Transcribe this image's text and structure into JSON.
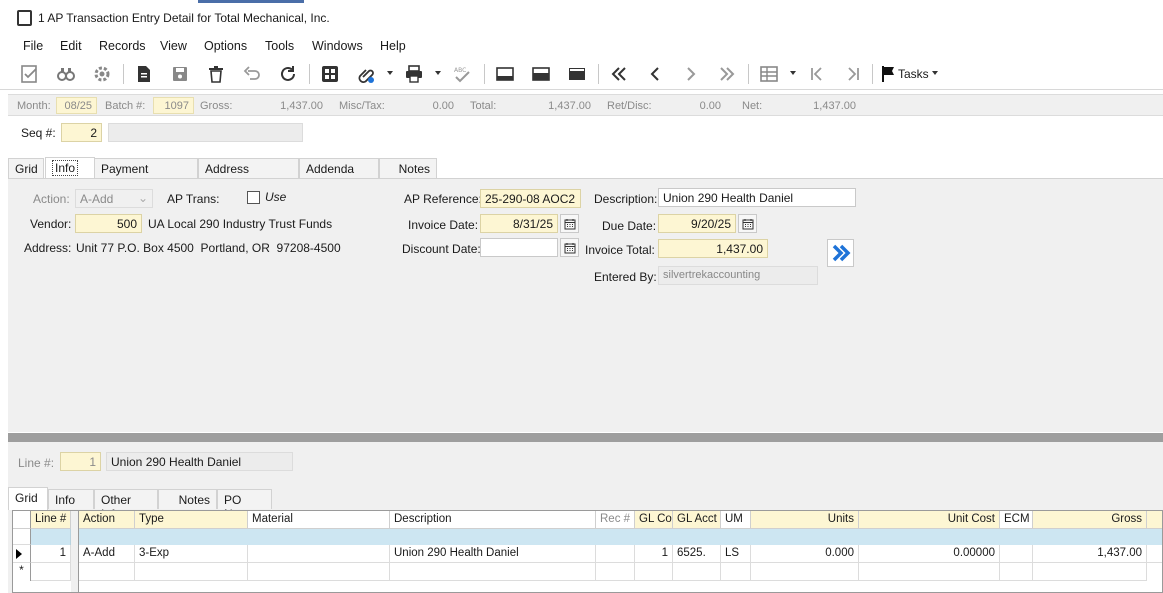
{
  "window": {
    "title": "1 AP Transaction Entry Detail for Total Mechanical, Inc."
  },
  "menu": [
    "File",
    "Edit",
    "Records",
    "View",
    "Options",
    "Tools",
    "Windows",
    "Help"
  ],
  "toolbar": {
    "tasks_label": "Tasks",
    "icons": [
      "validate-icon",
      "find-icon",
      "settings-icon",
      "new-record-icon",
      "save-icon",
      "delete-icon",
      "undo-icon",
      "refresh-icon",
      "related-icon",
      "attach-icon",
      "print-icon",
      "spellcheck-icon",
      "layout-1-icon",
      "layout-2-icon",
      "layout-3-icon",
      "first-icon",
      "previous-icon",
      "next-icon",
      "last-icon",
      "grid-view-icon",
      "begin-icon",
      "end-icon",
      "flag-icon"
    ]
  },
  "batch": {
    "month_label": "Month:",
    "month_value": "08/25",
    "batch_label": "Batch #:",
    "batch_value": "1097",
    "gross_label": "Gross:",
    "gross_value": "1,437.00",
    "misc_label": "Misc/Tax:",
    "misc_value": "0.00",
    "total_label": "Total:",
    "total_value": "1,437.00",
    "ret_label": "Ret/Disc:",
    "ret_value": "0.00",
    "net_label": "Net:",
    "net_value": "1,437.00"
  },
  "seq": {
    "label": "Seq #:",
    "value": "2",
    "desc": ""
  },
  "header_tabs": [
    "Grid",
    "Info",
    "Payment Overrides",
    "Address Overrides",
    "Addenda Info",
    "Notes"
  ],
  "info": {
    "action_label": "Action:",
    "action_value": "A-Add",
    "ap_trans_label": "AP Trans:",
    "use_label": "Use",
    "vendor_label": "Vendor:",
    "vendor_value": "500",
    "vendor_name": "UA Local 290 Industry Trust Funds",
    "address_label": "Address:",
    "address_value": "Unit 77 P.O. Box 4500  Portland, OR  97208-4500",
    "apref_label": "AP Reference:",
    "apref_value": "25-290-08 AOC2",
    "invdate_label": "Invoice Date:",
    "invdate_value": "8/31/25",
    "discdate_label": "Discount Date:",
    "discdate_value": "",
    "desc_label": "Description:",
    "desc_value": "Union 290 Health Daniel",
    "duedate_label": "Due Date:",
    "duedate_value": "9/20/25",
    "invtotal_label": "Invoice Total:",
    "invtotal_value": "1,437.00",
    "enteredby_label": "Entered By:",
    "enteredby_value": "silvertrekaccounting"
  },
  "line": {
    "label": "Line #:",
    "value": "1",
    "desc": "Union 290 Health Daniel"
  },
  "line_tabs": [
    "Grid",
    "Info",
    "Other Info",
    "Notes",
    "PO Notes"
  ],
  "grid": {
    "columns": [
      "Line #",
      "Action",
      "Type",
      "Material",
      "Description",
      "Rec #",
      "GL Co",
      "GL Acct",
      "UM",
      "Units",
      "Unit Cost",
      "ECM",
      "Gross"
    ],
    "rows": [
      {
        "line": "1",
        "action": "A-Add",
        "type": "3-Exp",
        "material": "",
        "description": "Union 290 Health Daniel",
        "rec": "",
        "glco": "1",
        "glacct": "6525.",
        "um": "LS",
        "units": "0.000",
        "unitcost": "0.00000",
        "ecm": "",
        "gross": "1,437.00"
      }
    ],
    "new_row_marker": "*"
  }
}
